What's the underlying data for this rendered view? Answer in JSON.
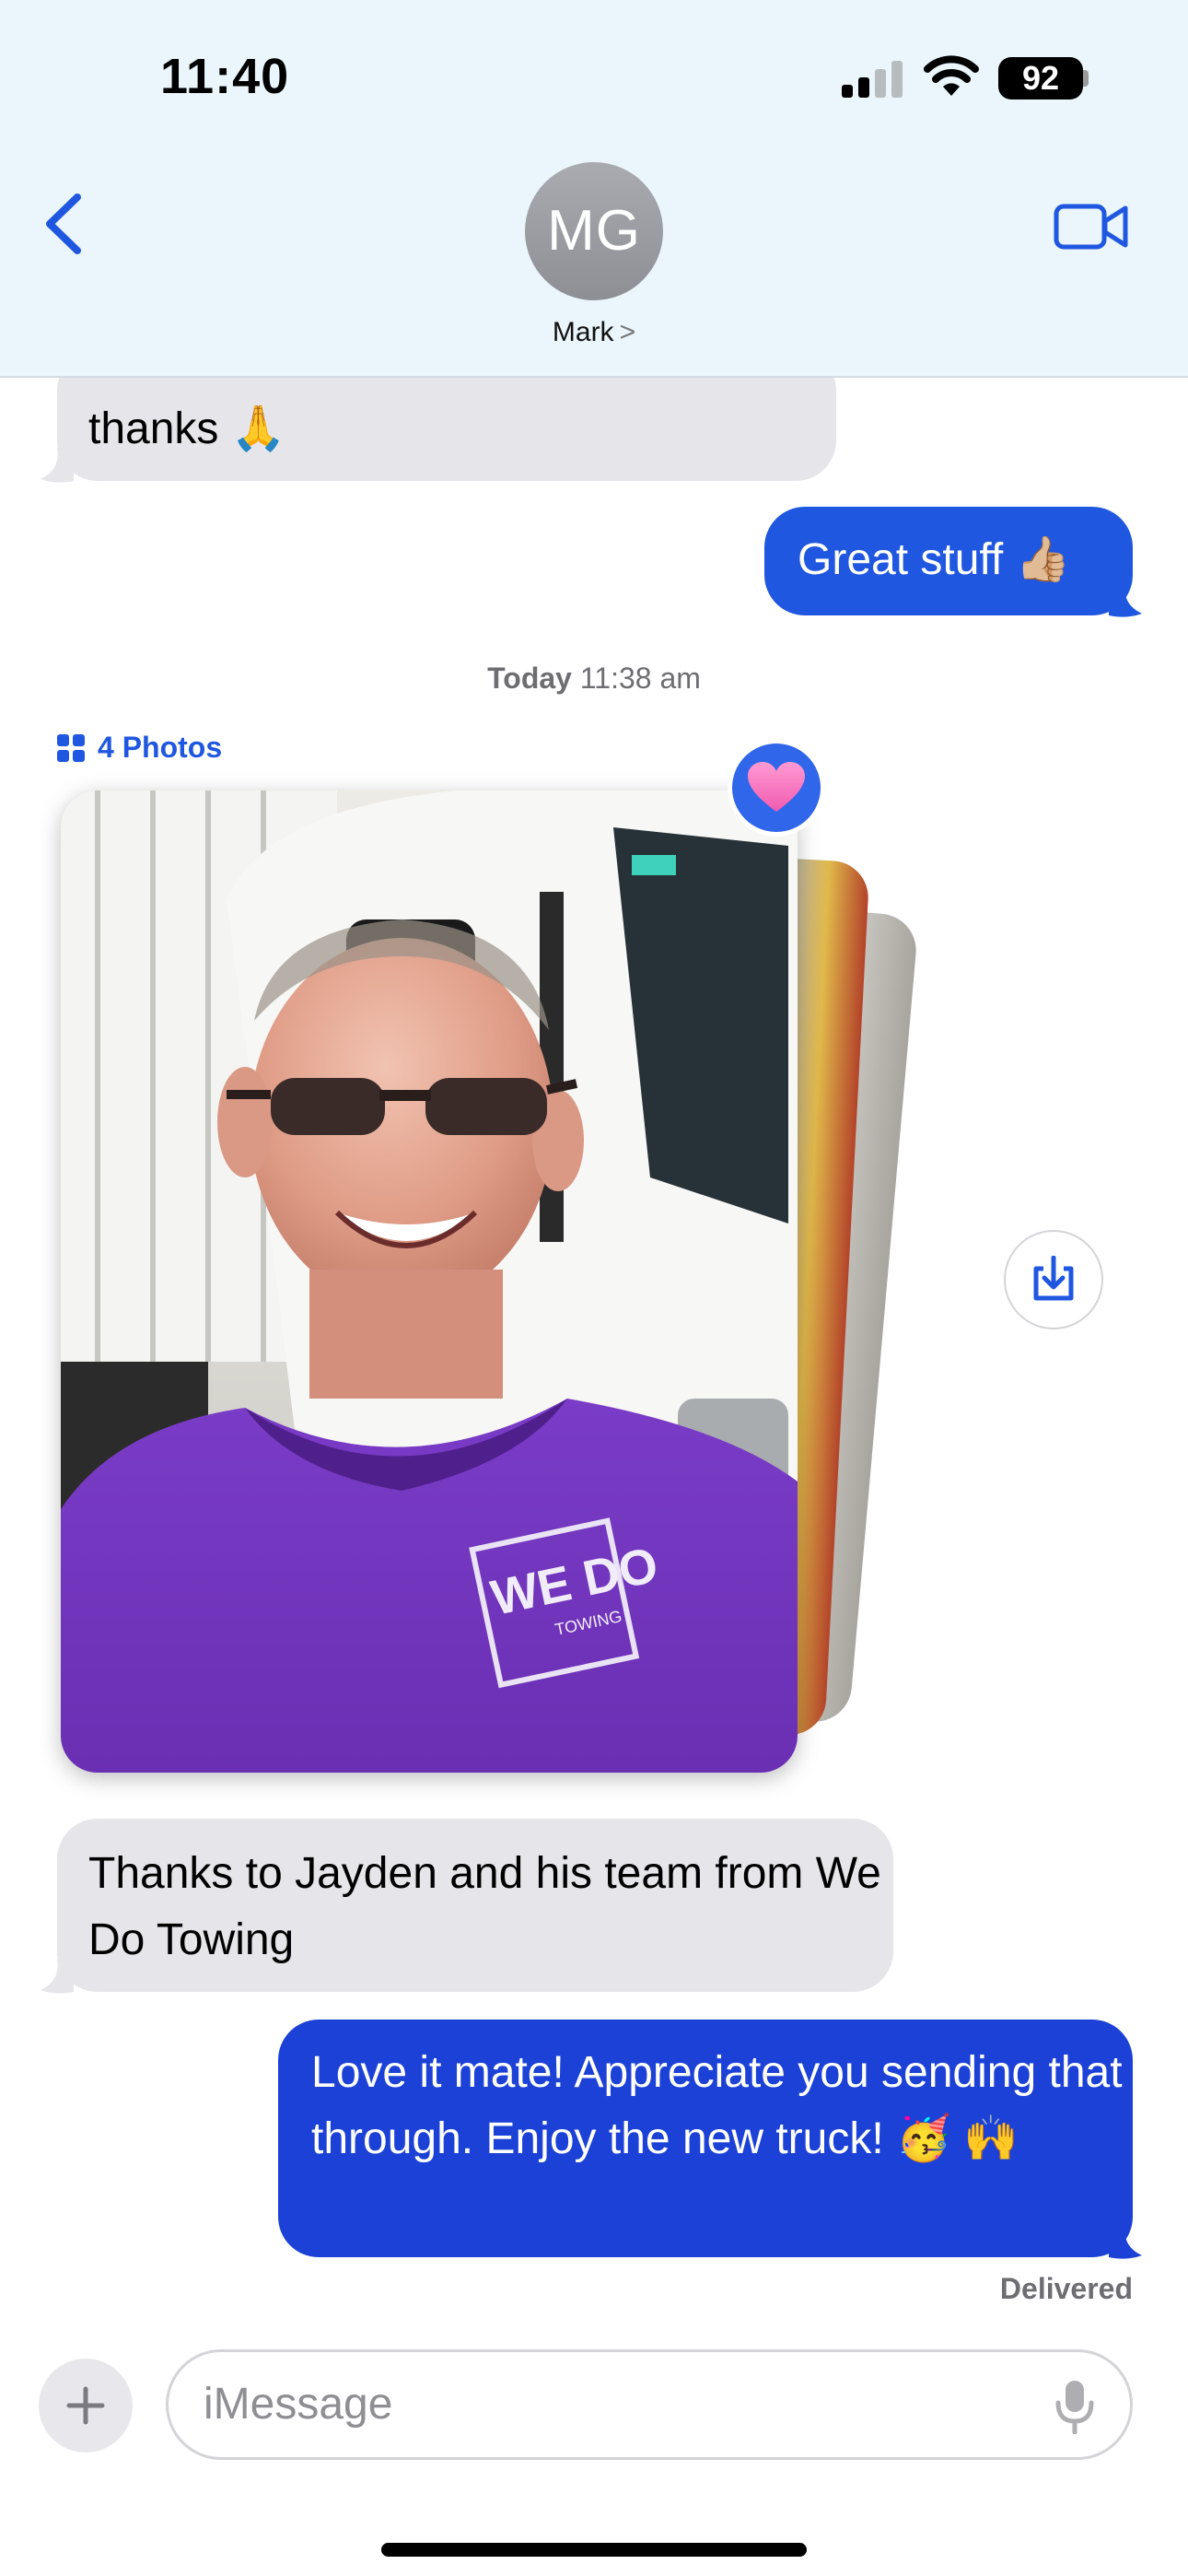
{
  "status_bar": {
    "time": "11:40",
    "battery": "92"
  },
  "header": {
    "avatar_initials": "MG",
    "contact_name": "Mark",
    "contact_chevron": ">"
  },
  "messages": [
    {
      "direction": "in",
      "text": "thanks 🙏"
    },
    {
      "direction": "out",
      "text": "Great stuff 👍🏼"
    },
    {
      "direction": "in",
      "text": "Thanks to Jayden and his team from We Do Towing"
    },
    {
      "direction": "out",
      "text": "Love it mate! Appreciate you sending that through. Enjoy the new truck! 🥳 🙌"
    }
  ],
  "timestamp": {
    "day": "Today",
    "time": "11:38 am"
  },
  "photo_group": {
    "label": "4 Photos",
    "count": 4,
    "reaction": "heart",
    "shirt_text": "WE DO",
    "shirt_subtext": "TOWING"
  },
  "status": {
    "delivered": "Delivered"
  },
  "input": {
    "placeholder": "iMessage"
  },
  "colors": {
    "outgoing": "#2057e0",
    "incoming": "#e5e5ea",
    "accent": "#2057e0",
    "header_bg": "#eaf6fb"
  },
  "icons": [
    "back-chevron-icon",
    "video-camera-icon",
    "grid-icon",
    "heart-icon",
    "download-icon",
    "plus-icon",
    "mic-icon",
    "signal-icon",
    "wifi-icon",
    "battery-icon"
  ]
}
